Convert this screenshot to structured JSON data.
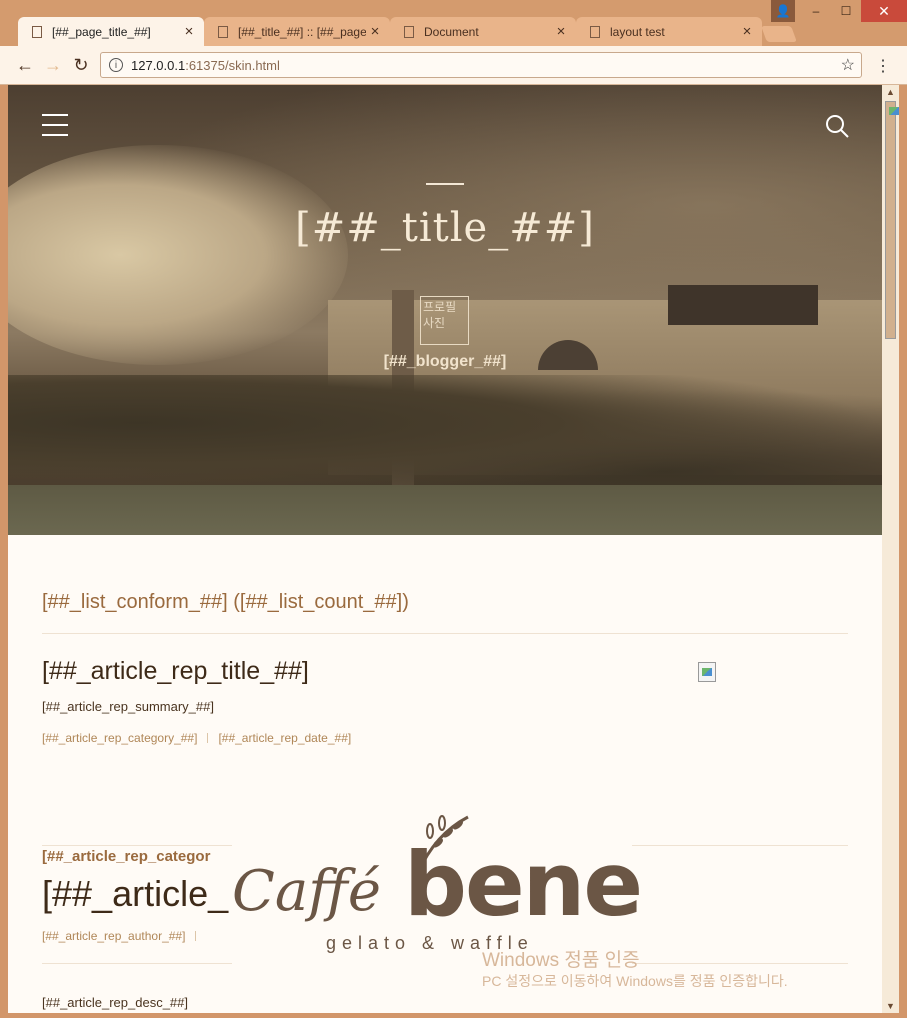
{
  "browser": {
    "tabs": [
      {
        "label": "[##_page_title_##]",
        "active": true
      },
      {
        "label": "[##_title_##] :: [##_page_title_##]",
        "active": false
      },
      {
        "label": "Document",
        "active": false
      },
      {
        "label": "layout test",
        "active": false
      }
    ],
    "url_host": "127.0.0.1",
    "url_path": ":61375/skin.html",
    "close_glyph": "✕",
    "minimize_glyph": "–",
    "maximize_glyph": "☐"
  },
  "hero": {
    "title": "[##_title_##]",
    "avatar_alt": "프로필사진",
    "blogger": "[##_blogger_##]",
    "icons": [
      "pencil-icon",
      "notebook-icon",
      "rss-icon",
      "gear-icon"
    ]
  },
  "list": {
    "heading": "[##_list_conform_##] ([##_list_count_##])"
  },
  "article1": {
    "title": "[##_article_rep_title_##]",
    "summary": "[##_article_rep_summary_##]",
    "category": "[##_article_rep_category_##]",
    "date": "[##_article_rep_date_##]"
  },
  "article2": {
    "category": "[##_article_rep_categor",
    "title": "[##_article_",
    "author": "[##_article_rep_author_##]",
    "desc": "[##_article_rep_desc_##]"
  },
  "overlay": {
    "brand_script": "Caffé",
    "brand_bold": "bene",
    "brand_sub": "gelato & waffle",
    "windows_line1": "Windows 정품 인증",
    "windows_line2": "PC 설정으로 이동하여 Windows를 정품 인증합니다."
  },
  "colors": {
    "chrome": "#d49b6e",
    "accent": "#9a6a3e",
    "brand": "#6b5645"
  }
}
